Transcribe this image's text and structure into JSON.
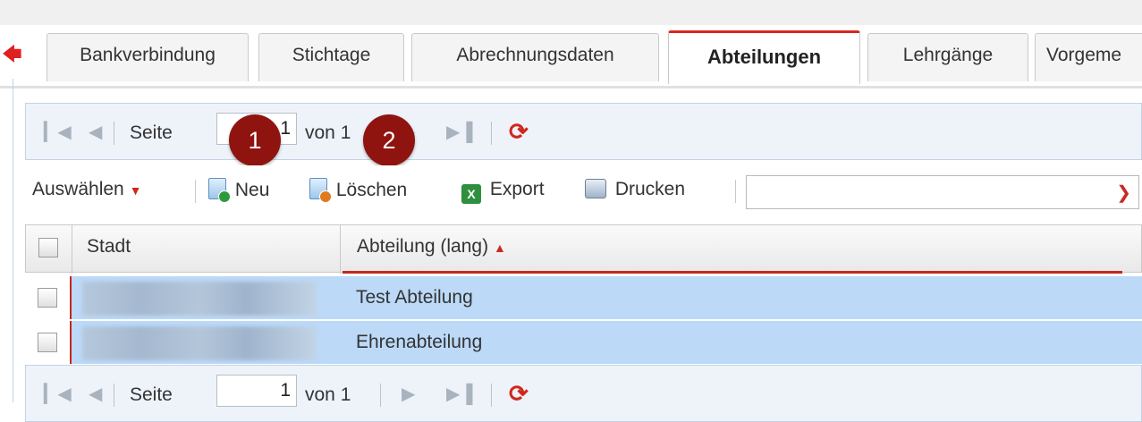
{
  "tabs": [
    {
      "label": "Bankverbindung",
      "active": false
    },
    {
      "label": "Stichtage",
      "active": false
    },
    {
      "label": "Abrechnungsdaten",
      "active": false
    },
    {
      "label": "Abteilungen",
      "active": true
    },
    {
      "label": "Lehrgänge",
      "active": false
    },
    {
      "label": "Vorgeme",
      "active": false
    }
  ],
  "pager": {
    "page_label": "Seite",
    "page_value": "1",
    "of_label": "von 1"
  },
  "badges": [
    "1",
    "2"
  ],
  "toolbar": {
    "select_label": "Auswählen",
    "new_label": "Neu",
    "delete_label": "Löschen",
    "export_label": "Export",
    "print_label": "Drucken",
    "filter_value": ""
  },
  "grid": {
    "columns": [
      "Stadt",
      "Abteilung (lang)"
    ],
    "sorted_column": "Abteilung (lang)",
    "sort_direction": "asc",
    "rows": [
      {
        "stadt": "",
        "abteilung": "Test Abteilung"
      },
      {
        "stadt": "",
        "abteilung": "Ehrenabteilung"
      }
    ]
  },
  "colors": {
    "accent_red": "#d9261c",
    "selection_blue": "#bcd9f8",
    "badge_red": "#8f1410"
  }
}
